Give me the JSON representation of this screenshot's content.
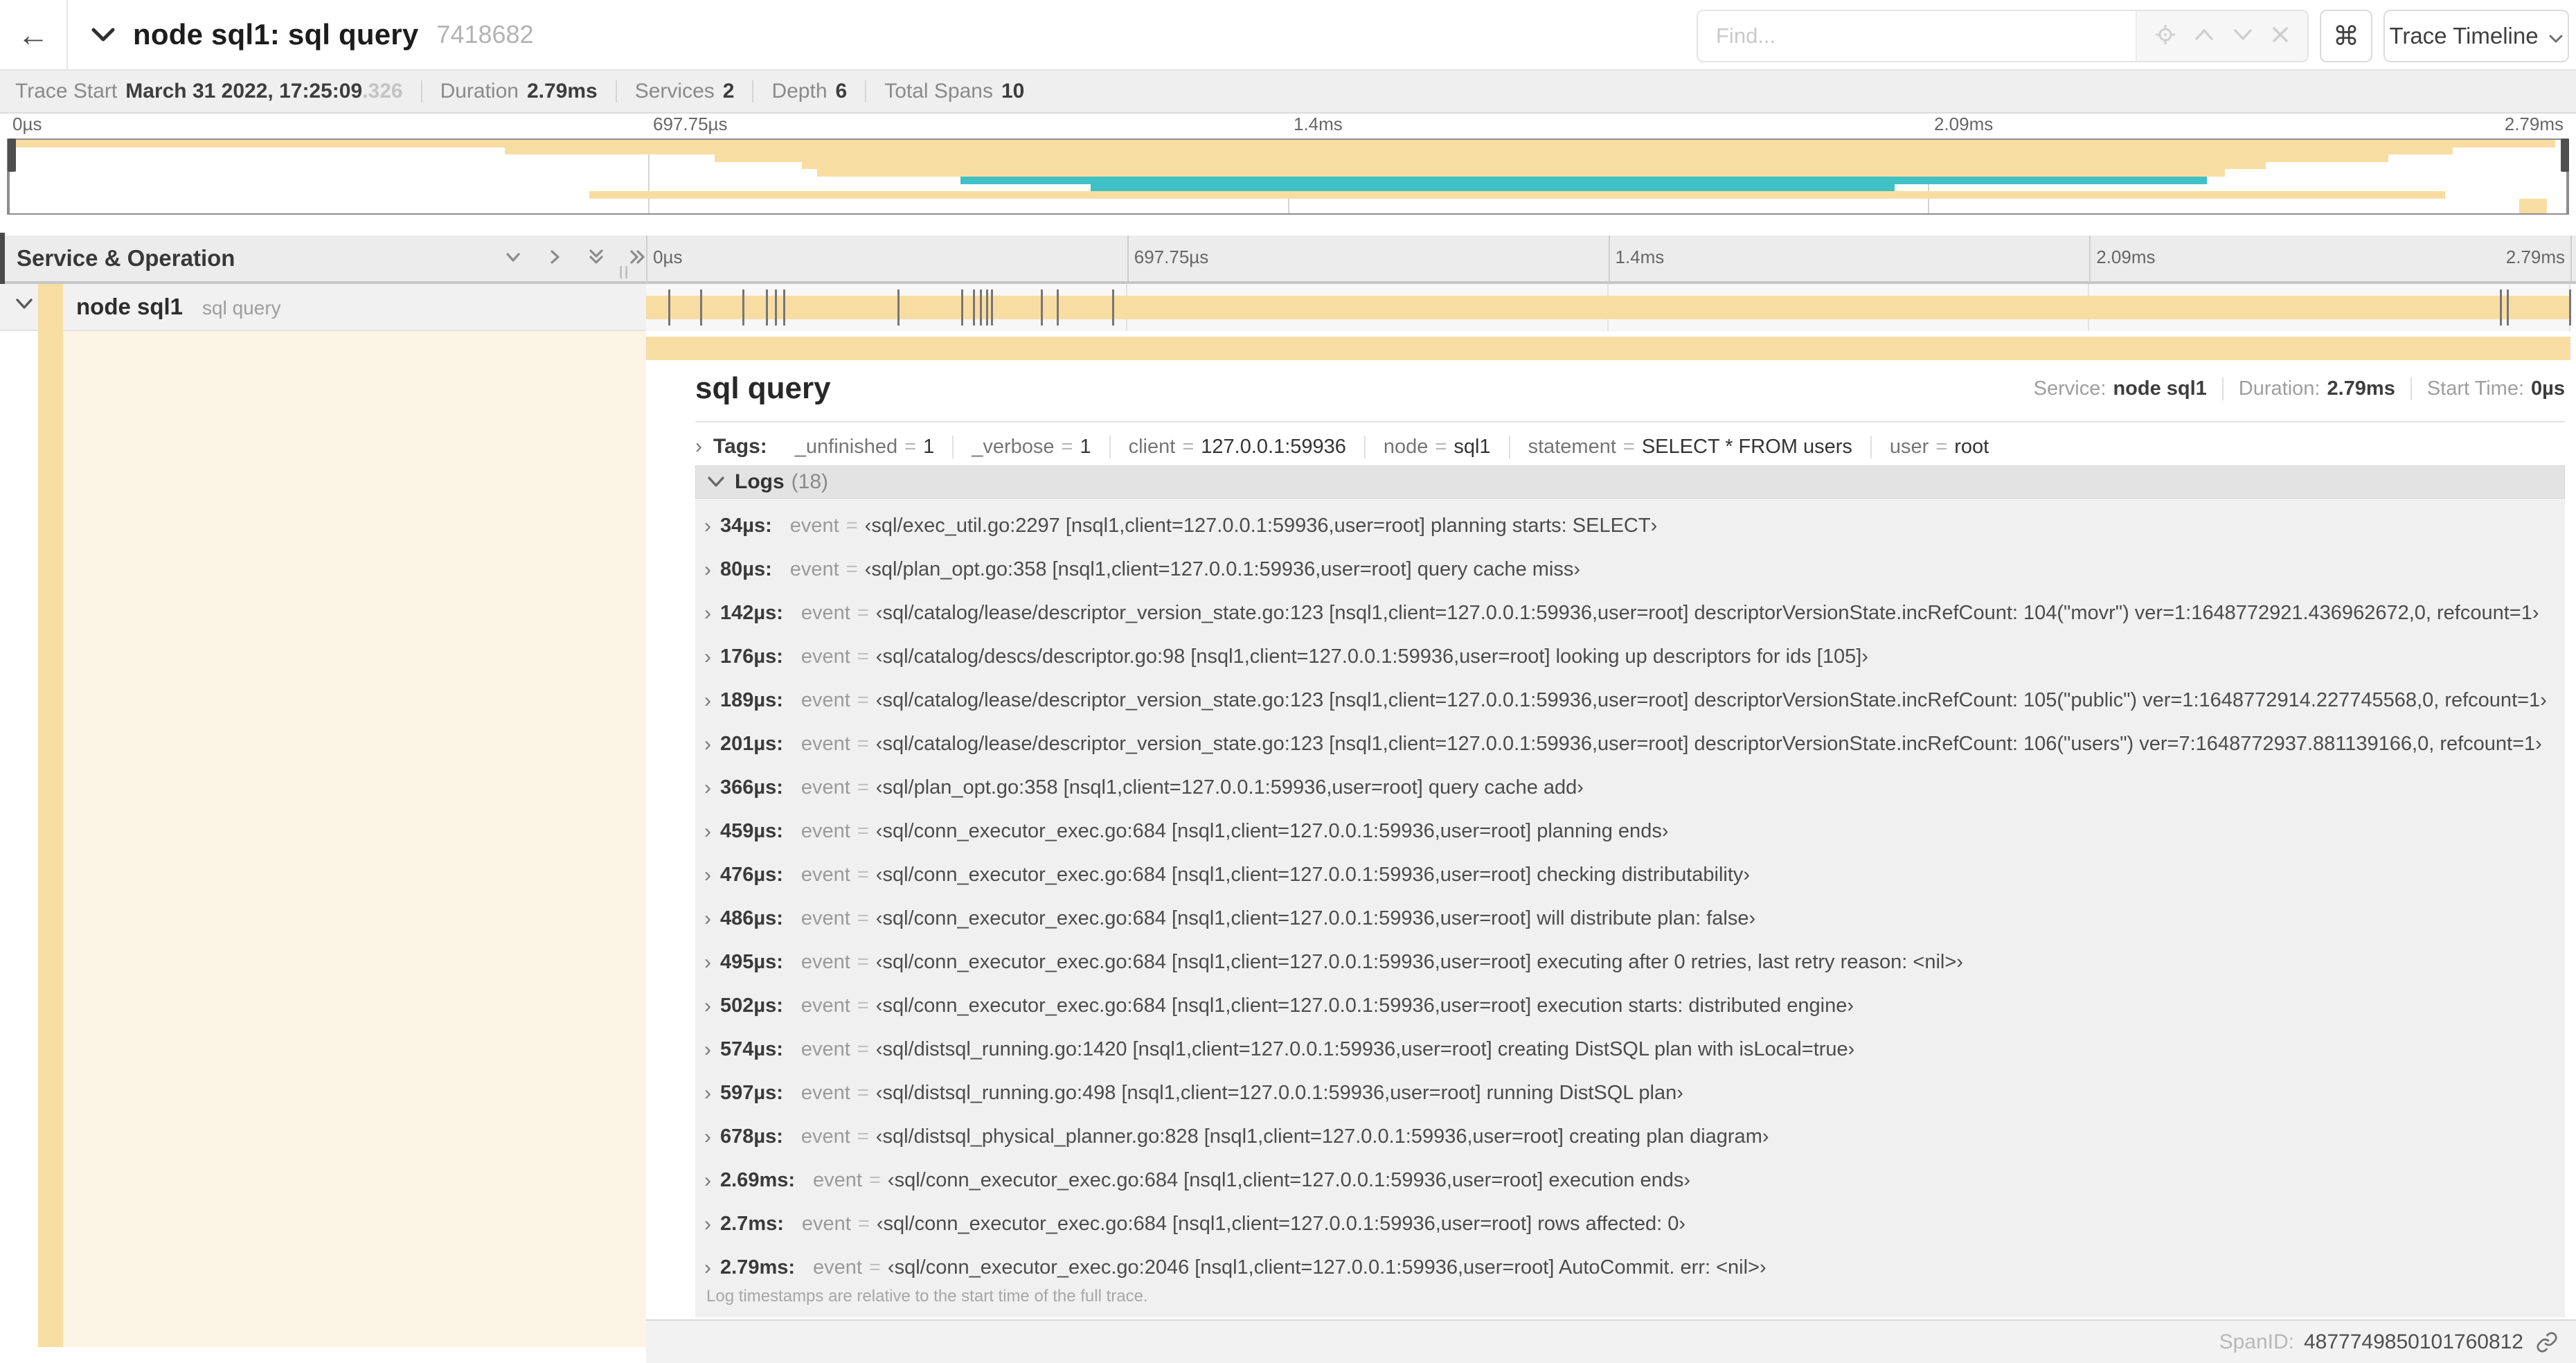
{
  "header": {
    "back_icon": "←",
    "title": "node sql1: sql query",
    "trace_id": "7418682",
    "find": {
      "placeholder": "Find..."
    },
    "shortcut_key": "⌘",
    "view_select": {
      "label": "Trace Timeline"
    }
  },
  "stats": {
    "items": [
      {
        "label": "Trace Start",
        "value": "March 31 2022, 17:25:09",
        "muted_suffix": ".326"
      },
      {
        "label": "Duration",
        "value": "2.79ms"
      },
      {
        "label": "Services",
        "value": "2"
      },
      {
        "label": "Depth",
        "value": "6"
      },
      {
        "label": "Total Spans",
        "value": "10"
      }
    ]
  },
  "timeline": {
    "duration_us": 2790,
    "ticks": [
      {
        "label": "0µs",
        "pos": 0
      },
      {
        "label": "697.75µs",
        "pos": 0.25
      },
      {
        "label": "1.4ms",
        "pos": 0.5
      },
      {
        "label": "2.09ms",
        "pos": 0.75
      },
      {
        "label": "2.79ms",
        "pos": 1
      }
    ],
    "minimap_spans": [
      {
        "start": 0.002,
        "end": 0.995,
        "color": "#F8DDA3"
      },
      {
        "start": 0.194,
        "end": 0.955,
        "color": "#F8DDA3"
      },
      {
        "start": 0.276,
        "end": 0.93,
        "color": "#F8DDA3"
      },
      {
        "start": 0.31,
        "end": 0.882,
        "color": "#F8DDA3"
      },
      {
        "start": 0.316,
        "end": 0.866,
        "color": "#F8DDA3"
      },
      {
        "start": 0.372,
        "end": 0.859,
        "color": "#40C1C6"
      },
      {
        "start": 0.423,
        "end": 0.737,
        "color": "#40C1C6"
      },
      {
        "start": 0.227,
        "end": 0.952,
        "color": "#F8DDA3"
      },
      {
        "start": 0.981,
        "end": 0.992,
        "color": "#F8DDA3"
      },
      {
        "start": 0.981,
        "end": 0.992,
        "color": "#F8DDA3"
      }
    ]
  },
  "grid": {
    "header": "Service & Operation"
  },
  "span_row": {
    "service": "node sql1",
    "operation": "sql query"
  },
  "detail": {
    "operation": "sql query",
    "meta": [
      {
        "label": "Service:",
        "value": "node sql1"
      },
      {
        "label": "Duration:",
        "value": "2.79ms"
      },
      {
        "label": "Start Time:",
        "value": "0µs"
      }
    ],
    "tags_label": "Tags:",
    "tags": [
      {
        "key": "_unfinished",
        "value": "1"
      },
      {
        "key": "_verbose",
        "value": "1"
      },
      {
        "key": "client",
        "value": "127.0.0.1:59936"
      },
      {
        "key": "node",
        "value": "sql1"
      },
      {
        "key": "statement",
        "value": "SELECT * FROM users"
      },
      {
        "key": "user",
        "value": "root"
      }
    ],
    "logs_label": "Logs",
    "logs_count": "(18)",
    "logs": [
      {
        "time": "34µs",
        "t_us": 34,
        "key": "event",
        "value": "sql/exec_util.go:2297 [nsql1,client=127.0.0.1:59936,user=root] planning starts: SELECT"
      },
      {
        "time": "80µs",
        "t_us": 80,
        "key": "event",
        "value": "sql/plan_opt.go:358 [nsql1,client=127.0.0.1:59936,user=root] query cache miss"
      },
      {
        "time": "142µs",
        "t_us": 142,
        "key": "event",
        "value": "sql/catalog/lease/descriptor_version_state.go:123 [nsql1,client=127.0.0.1:59936,user=root] descriptorVersionState.incRefCount: 104(\"movr\") ver=1:1648772921.436962672,0, refcount=1"
      },
      {
        "time": "176µs",
        "t_us": 176,
        "key": "event",
        "value": "sql/catalog/descs/descriptor.go:98 [nsql1,client=127.0.0.1:59936,user=root] looking up descriptors for ids [105]"
      },
      {
        "time": "189µs",
        "t_us": 189,
        "key": "event",
        "value": "sql/catalog/lease/descriptor_version_state.go:123 [nsql1,client=127.0.0.1:59936,user=root] descriptorVersionState.incRefCount: 105(\"public\") ver=1:1648772914.227745568,0, refcount=1"
      },
      {
        "time": "201µs",
        "t_us": 201,
        "key": "event",
        "value": "sql/catalog/lease/descriptor_version_state.go:123 [nsql1,client=127.0.0.1:59936,user=root] descriptorVersionState.incRefCount: 106(\"users\") ver=7:1648772937.881139166,0, refcount=1"
      },
      {
        "time": "366µs",
        "t_us": 366,
        "key": "event",
        "value": "sql/plan_opt.go:358 [nsql1,client=127.0.0.1:59936,user=root] query cache add"
      },
      {
        "time": "459µs",
        "t_us": 459,
        "key": "event",
        "value": "sql/conn_executor_exec.go:684 [nsql1,client=127.0.0.1:59936,user=root] planning ends"
      },
      {
        "time": "476µs",
        "t_us": 476,
        "key": "event",
        "value": "sql/conn_executor_exec.go:684 [nsql1,client=127.0.0.1:59936,user=root] checking distributability"
      },
      {
        "time": "486µs",
        "t_us": 486,
        "key": "event",
        "value": "sql/conn_executor_exec.go:684 [nsql1,client=127.0.0.1:59936,user=root] will distribute plan: false"
      },
      {
        "time": "495µs",
        "t_us": 495,
        "key": "event",
        "value": "sql/conn_executor_exec.go:684 [nsql1,client=127.0.0.1:59936,user=root] executing after 0 retries, last retry reason: <nil>"
      },
      {
        "time": "502µs",
        "t_us": 502,
        "key": "event",
        "value": "sql/conn_executor_exec.go:684 [nsql1,client=127.0.0.1:59936,user=root] execution starts: distributed engine"
      },
      {
        "time": "574µs",
        "t_us": 574,
        "key": "event",
        "value": "sql/distsql_running.go:1420 [nsql1,client=127.0.0.1:59936,user=root] creating DistSQL plan with isLocal=true"
      },
      {
        "time": "597µs",
        "t_us": 597,
        "key": "event",
        "value": "sql/distsql_running.go:498 [nsql1,client=127.0.0.1:59936,user=root] running DistSQL plan"
      },
      {
        "time": "678µs",
        "t_us": 678,
        "key": "event",
        "value": "sql/distsql_physical_planner.go:828 [nsql1,client=127.0.0.1:59936,user=root] creating plan diagram"
      },
      {
        "time": "2.69ms",
        "t_us": 2690,
        "key": "event",
        "value": "sql/conn_executor_exec.go:684 [nsql1,client=127.0.0.1:59936,user=root] execution ends"
      },
      {
        "time": "2.7ms",
        "t_us": 2700,
        "key": "event",
        "value": "sql/conn_executor_exec.go:684 [nsql1,client=127.0.0.1:59936,user=root] rows affected: 0"
      },
      {
        "time": "2.79ms",
        "t_us": 2790,
        "key": "event",
        "value": "sql/conn_executor_exec.go:2046 [nsql1,client=127.0.0.1:59936,user=root] AutoCommit. err: <nil>"
      }
    ],
    "logs_note": "Log timestamps are relative to the start time of the full trace.",
    "footer": {
      "label": "SpanID:",
      "value": "4877749850101760812"
    }
  },
  "colors": {
    "span_tan": "#F8DDA3",
    "span_teal": "#40C1C6",
    "detail_tint": "#FCF4E4"
  }
}
